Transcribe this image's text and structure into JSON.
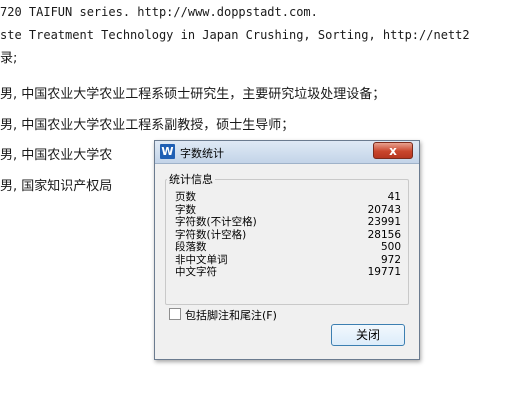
{
  "document": {
    "lines": [
      "720 TAIFUN series. http://www.doppstadt.com.",
      "ste Treatment Technology in Japan Crushing, Sorting, http://nett2",
      "录;",
      "男, 中国农业大学农业工程系硕士研究生，主要研究垃圾处理设备；",
      "男, 中国农业大学农业工程系副教授，硕士生导师；",
      "男, 中国农业大学农",
      "男, 国家知识产权局"
    ]
  },
  "dialog": {
    "title": "字数统计",
    "app_icon": "W",
    "close_label": "x",
    "group_title": "统计信息",
    "stats": [
      {
        "label": "页数",
        "value": "41"
      },
      {
        "label": "字数",
        "value": "20743"
      },
      {
        "label": "字符数(不计空格)",
        "value": "23991"
      },
      {
        "label": "字符数(计空格)",
        "value": "28156"
      },
      {
        "label": "段落数",
        "value": "500"
      },
      {
        "label": "非中文单词",
        "value": "972"
      },
      {
        "label": "中文字符",
        "value": "19771"
      }
    ],
    "checkbox_label": "包括脚注和尾注(F)",
    "close_button_label": "关闭"
  }
}
